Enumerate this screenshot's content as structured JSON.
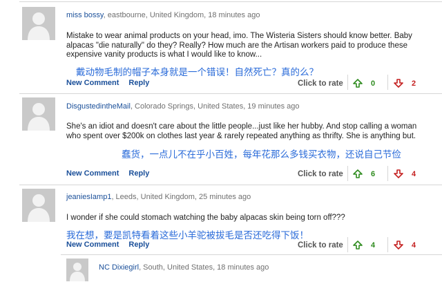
{
  "comments": [
    {
      "username": "miss bossy",
      "meta": ", eastbourne, United Kingdom, 18 minutes ago",
      "text": "Mistake to wear animal products on your head, imo. The Wisteria Sisters should know better. Baby alpacas \"die naturally\" do they? Really? How much are the Artisan workers paid to produce these expensive vanity products is what I would like to know...",
      "annotation": "戴动物毛制的帽子本身就是一个错误！自然死亡？真的么？",
      "new_comment_label": "New Comment",
      "reply_label": "Reply",
      "rate_label": "Click to rate",
      "up_count": "0",
      "down_count": "2"
    },
    {
      "username": "DisgustedintheMail",
      "meta": ", Colorado Springs, United States, 19 minutes ago",
      "text": "She's an idiot and doesn't care about the little people...just like her hubby. And stop calling a woman who spent over $200k on clothes last year & rarely repeated anything as thrifty. She is anything but.",
      "annotation": "蠢货，一点儿不在乎小百姓，每年花那么多钱买衣物，还说自己节俭",
      "new_comment_label": "New Comment",
      "reply_label": "Reply",
      "rate_label": "Click to rate",
      "up_count": "6",
      "down_count": "4"
    },
    {
      "username": "jeaniesIamp1",
      "meta": ", Leeds, United Kingdom, 25 minutes ago",
      "text": "I wonder if she could stomach watching the baby alpacas skin being torn off???",
      "annotation": "我在想，要是凯特看着这些小羊驼被拔毛是否还吃得下饭！",
      "new_comment_label": "New Comment",
      "reply_label": "Reply",
      "rate_label": "Click to rate",
      "up_count": "4",
      "down_count": "4"
    }
  ],
  "reply_preview": {
    "username": "NC Dixiegirl",
    "meta": ", South, United States, 18 minutes ago"
  },
  "colors": {
    "link": "#1a4f99",
    "annotation": "#2a6bd9",
    "up": "#2e8b1e",
    "down": "#c41f1f"
  },
  "icons": {
    "avatar": "default-avatar-icon",
    "up": "thumb-up-arrow-icon",
    "down": "thumb-down-arrow-icon"
  }
}
